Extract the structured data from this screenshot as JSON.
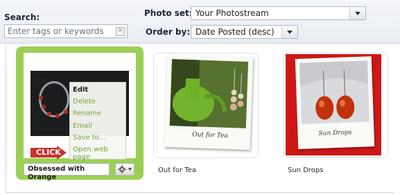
{
  "toolbar": {
    "search_label": "Search:",
    "search_placeholder": "Enter tags or keywords",
    "photo_set_label": "Photo set:",
    "photo_set_value": "Your Photostream",
    "order_label": "Order by:",
    "order_value": "Date Posted (desc)"
  },
  "gallery": {
    "selected": {
      "title": "Obsessed with Orange",
      "menu": [
        "Edit",
        "Delete",
        "Rename",
        "Email",
        "Save to...",
        "Open web page"
      ],
      "active_menu_item": "Edit",
      "callout": "CLICK"
    },
    "photos": [
      {
        "title": "Out for Tea",
        "caption": "Out for Tea"
      },
      {
        "title": "Sun Drops",
        "caption": "Sun Drops"
      }
    ]
  },
  "colors": {
    "selection_green": "#9bd055",
    "menu_green": "#77a336",
    "click_red": "#c8332f"
  }
}
